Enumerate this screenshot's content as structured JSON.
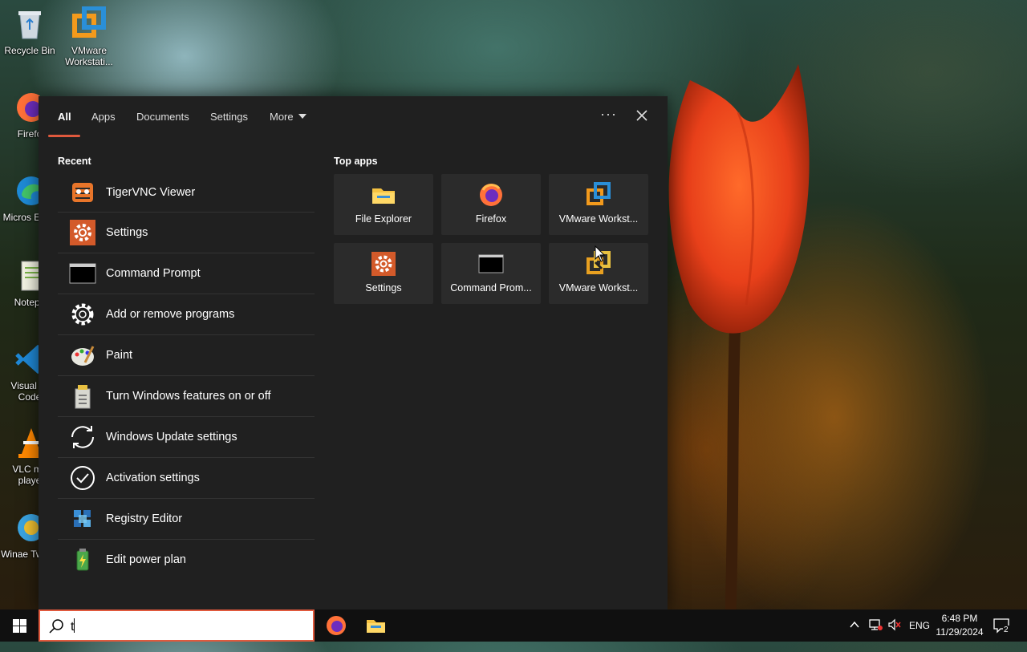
{
  "desktop": {
    "icons": [
      {
        "name": "recycle-bin",
        "label": "Recycle Bin"
      },
      {
        "name": "vmware-workstation",
        "label": "VMware Workstati..."
      },
      {
        "name": "firefox",
        "label": "Firefo"
      },
      {
        "name": "microsoft-edge",
        "label": "Micros Edge"
      },
      {
        "name": "notepad",
        "label": "Notepa"
      },
      {
        "name": "visual-studio-code",
        "label": "Visual St Code"
      },
      {
        "name": "vlc",
        "label": "VLC me playe"
      },
      {
        "name": "winaero-tweaker",
        "label": "Winae Tweak"
      }
    ]
  },
  "search_panel": {
    "tabs": [
      "All",
      "Apps",
      "Documents",
      "Settings",
      "More"
    ],
    "active_tab": "All",
    "recent_title": "Recent",
    "recent": [
      {
        "label": "TigerVNC Viewer",
        "icon": "tigervnc-icon"
      },
      {
        "label": "Settings",
        "icon": "settings-icon"
      },
      {
        "label": "Command Prompt",
        "icon": "command-prompt-icon"
      },
      {
        "label": "Add or remove programs",
        "icon": "gear-icon"
      },
      {
        "label": "Paint",
        "icon": "paint-icon"
      },
      {
        "label": "Turn Windows features on or off",
        "icon": "windows-features-icon"
      },
      {
        "label": "Windows Update settings",
        "icon": "update-icon"
      },
      {
        "label": "Activation settings",
        "icon": "activation-icon"
      },
      {
        "label": "Registry Editor",
        "icon": "registry-editor-icon"
      },
      {
        "label": "Edit power plan",
        "icon": "power-plan-icon"
      }
    ],
    "top_apps_title": "Top apps",
    "top_apps": [
      {
        "label": "File Explorer",
        "icon": "file-explorer-icon"
      },
      {
        "label": "Firefox",
        "icon": "firefox-icon"
      },
      {
        "label": "VMware Workst...",
        "icon": "vmware-icon"
      },
      {
        "label": "Settings",
        "icon": "settings-icon"
      },
      {
        "label": "Command Prom...",
        "icon": "command-prompt-icon"
      },
      {
        "label": "VMware Workst...",
        "icon": "vmware-player-icon"
      }
    ]
  },
  "taskbar": {
    "search_value": "t",
    "language": "ENG",
    "time": "6:48 PM",
    "date": "11/29/2024",
    "notification_count": "2"
  },
  "colors": {
    "accent": "#e0593d",
    "panel": "#202020",
    "tile": "#2b2b2b"
  }
}
